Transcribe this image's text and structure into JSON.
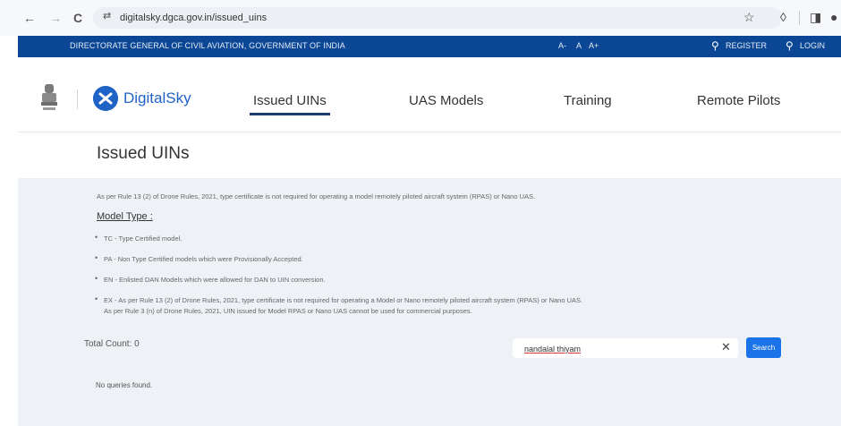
{
  "browser": {
    "back_icon": "←",
    "forward_icon": "→",
    "reload_icon": "C",
    "tune_icon": "⇄",
    "url": "digitalsky.dgca.gov.in/issued_uins",
    "star_icon": "☆",
    "extension_icon": "◊",
    "sidebar_icon": "◨",
    "profile_icon": "●"
  },
  "govbar": {
    "text": "DIRECTORATE GENERAL OF CIVIL AVIATION, GOVERNMENT OF INDIA",
    "font_decrease": "A-",
    "font_normal": "A",
    "font_increase": "A+",
    "register_icon": "⚲",
    "register": "REGISTER",
    "login_icon": "⚲",
    "login": "LOGIN"
  },
  "header": {
    "logo_text": "DigitalSky",
    "nav": [
      "Issued UINs",
      "UAS Models",
      "Training",
      "Remote Pilots"
    ],
    "active_index": 0
  },
  "page": {
    "title": "Issued UINs",
    "rule_note": "As per Rule 13 (2) of Drone Rules, 2021, type certificate is not required for operating a model remotely piloted aircraft system (RPAS) or Nano UAS.",
    "model_type_heading": "Model Type :",
    "bullets": [
      "TC - Type Certified model.",
      "PA - Non Type Certified models which were Provisionally Accepted.",
      "EN - Enlisted DAN Models which were allowed for DAN to UIN conversion.",
      "EX - As per Rule 13 (2) of Drone Rules, 2021, type certificate is not required for operating a Model or Nano remotely piloted aircraft system (RPAS) or Nano UAS."
    ],
    "bullet_ex_line2": "As per Rule 3 (n) of Drone Rules, 2021, UIN issued for Model RPAS or Nano UAS cannot be used for commercial purposes.",
    "total_count": "Total Count: 0",
    "search_value": "nandalal thiyam",
    "clear_icon": "✕",
    "search_button": "Search",
    "no_results": "No queries found."
  },
  "colors": {
    "gov_blue": "#0b4795",
    "brand_blue": "#1f63c6",
    "search_button": "#1a73e8",
    "panel_bg": "#eef1f5"
  }
}
